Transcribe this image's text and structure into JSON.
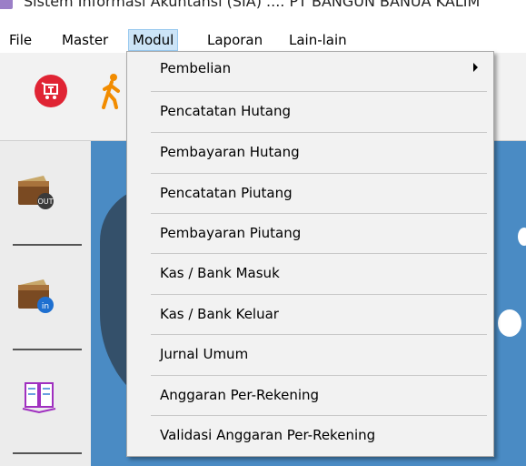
{
  "window": {
    "title": "Sistem Informasi Akuntansi (SIA) .... PT BANGUN BANUA KALIM"
  },
  "menubar": {
    "items": [
      {
        "label": "File"
      },
      {
        "label": "Master"
      },
      {
        "label": "Modul"
      },
      {
        "label": "Laporan"
      },
      {
        "label": "Lain-lain"
      }
    ],
    "active": "Modul"
  },
  "dropdown": {
    "items": [
      {
        "label": "Pembelian",
        "has_submenu": true
      },
      {
        "label": "Pencatatan Hutang"
      },
      {
        "label": "Pembayaran Hutang"
      },
      {
        "label": "Pencatatan Piutang"
      },
      {
        "label": "Pembayaran Piutang"
      },
      {
        "label": "Kas / Bank Masuk"
      },
      {
        "label": "Kas / Bank Keluar"
      },
      {
        "label": "Jurnal Umum"
      },
      {
        "label": "Anggaran Per-Rekening"
      },
      {
        "label": "Validasi Anggaran Per-Rekening"
      }
    ]
  },
  "toolbar": {
    "icons": [
      "shopping-cart-icon",
      "walking-person-icon"
    ]
  },
  "sidebar": {
    "buttons": [
      {
        "icon": "wallet-out-icon",
        "badge": "OUT"
      },
      {
        "icon": "wallet-in-icon",
        "badge": "in"
      },
      {
        "icon": "open-book-icon"
      }
    ]
  },
  "colors": {
    "menu_highlight": "#cce4f7",
    "cart_red": "#e02434",
    "walker_orange": "#f28c00",
    "background_blue": "#4a8bc4"
  }
}
